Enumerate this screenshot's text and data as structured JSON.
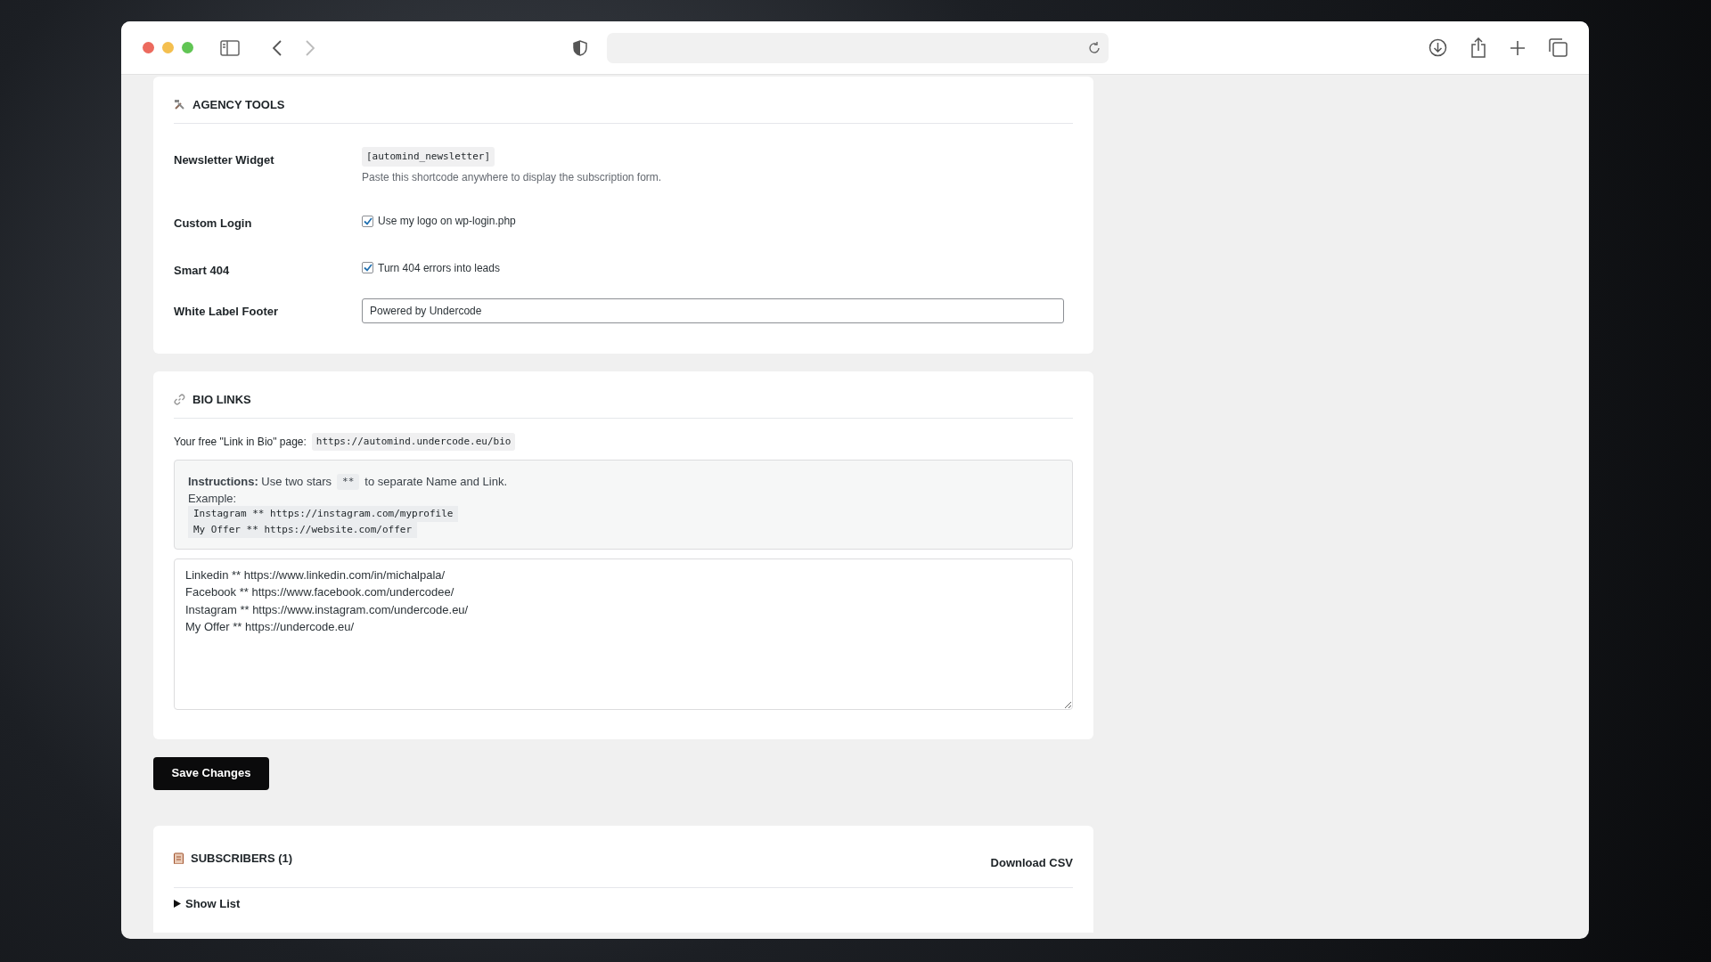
{
  "browser": {
    "forward_disabled": true
  },
  "agency_tools": {
    "title": "AGENCY TOOLS",
    "rows": [
      {
        "kind": "shortcode",
        "label": "Newsletter Widget",
        "code": "[automind_newsletter]",
        "hint": "Paste this shortcode anywhere to display the subscription form."
      },
      {
        "kind": "checkbox",
        "label": "Custom Login",
        "text": "Use my logo on wp-login.php",
        "checked": true
      },
      {
        "kind": "checkbox",
        "label": "Smart 404",
        "text": "Turn 404 errors into leads",
        "checked": true
      },
      {
        "kind": "text",
        "label": "White Label Footer",
        "value": "Powered by Undercode"
      }
    ]
  },
  "bio_links": {
    "title": "BIO LINKS",
    "page_label": "Your free \"Link in Bio\" page:",
    "page_url": "https://automind.undercode.eu/bio",
    "instructions": {
      "lead": "**Instructions:** Use two stars",
      "separator": "**",
      "after": "to separate Name and Link.",
      "example_label": "Example:",
      "examples": [
        "Instagram ** https://instagram.com/myprofile",
        "My Offer ** https://website.com/offer"
      ]
    },
    "links_value": "Linkedin ** https://www.linkedin.com/in/michalpala/\nFacebook ** https://www.facebook.com/undercodee/\nInstagram ** https://www.instagram.com/undercode.eu/\nMy Offer ** https://undercode.eu/"
  },
  "save_button": "Save Changes",
  "subscribers": {
    "title": "SUBSCRIBERS (1)",
    "download": "Download CSV",
    "toggle": "Show List",
    "expanded": false
  }
}
